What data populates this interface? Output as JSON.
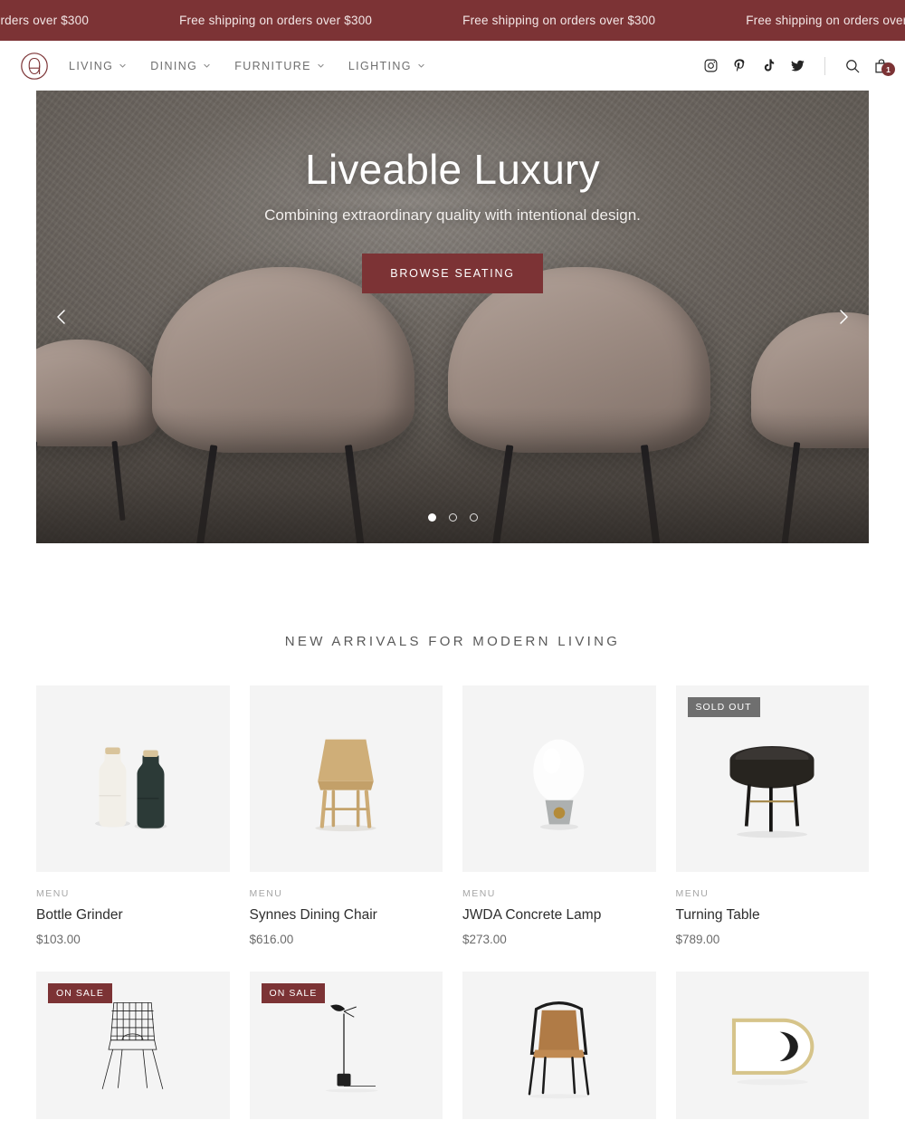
{
  "announcement": {
    "message": "Free shipping on orders over $300",
    "repeat": 6,
    "bg_color": "#7C3335"
  },
  "header": {
    "logo_name": "brand-monogram-a",
    "nav": [
      {
        "label": "Living",
        "icon": "chevron-down-icon"
      },
      {
        "label": "Dining",
        "icon": "chevron-down-icon"
      },
      {
        "label": "Furniture",
        "icon": "chevron-down-icon"
      },
      {
        "label": "Lighting",
        "icon": "chevron-down-icon"
      }
    ],
    "social": [
      {
        "name": "instagram-icon"
      },
      {
        "name": "pinterest-icon"
      },
      {
        "name": "tiktok-icon"
      },
      {
        "name": "twitter-icon"
      }
    ],
    "search_icon": "search-icon",
    "cart_icon": "shopping-bag-icon",
    "cart_count": "1"
  },
  "hero": {
    "title": "Liveable Luxury",
    "subtitle": "Combining extraordinary quality with intentional design.",
    "cta_label": "Browse Seating",
    "prev_icon": "chevron-left-icon",
    "next_icon": "chevron-right-icon",
    "slides": 3,
    "active_slide": 1,
    "accent_color": "#7C3335"
  },
  "section": {
    "title": "New Arrivals for Modern Living"
  },
  "products": [
    {
      "vendor": "MENU",
      "name": "Bottle Grinder",
      "price": "$103.00",
      "badge": "",
      "image": "bottle-grinder"
    },
    {
      "vendor": "MENU",
      "name": "Synnes Dining Chair",
      "price": "$616.00",
      "badge": "",
      "image": "wood-chair"
    },
    {
      "vendor": "MENU",
      "name": "JWDA Concrete Lamp",
      "price": "$273.00",
      "badge": "",
      "image": "globe-lamp"
    },
    {
      "vendor": "MENU",
      "name": "Turning Table",
      "price": "$789.00",
      "badge": "SOLD OUT",
      "image": "round-table"
    }
  ],
  "products_row2": [
    {
      "badge": "ON SALE",
      "image": "wire-chair"
    },
    {
      "badge": "ON SALE",
      "image": "floor-lamp"
    },
    {
      "badge": "",
      "image": "leather-chair"
    },
    {
      "badge": "",
      "image": "brass-mirror"
    }
  ]
}
